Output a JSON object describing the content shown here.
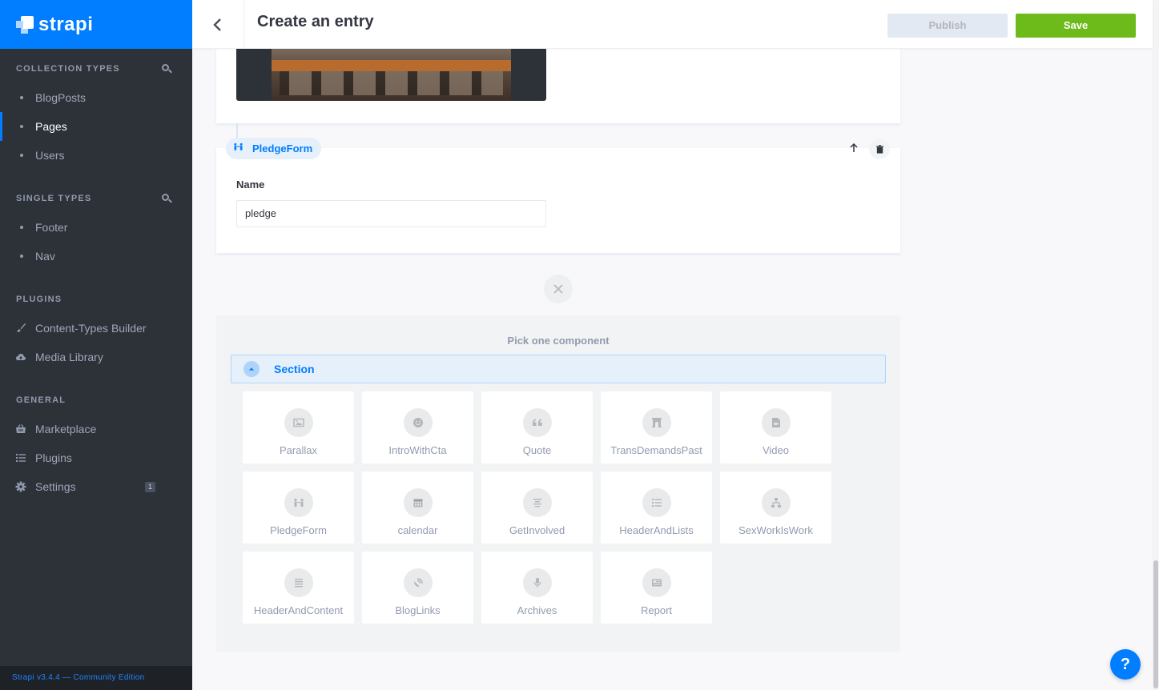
{
  "brand": {
    "name": "strapi"
  },
  "sidebar": {
    "sections": [
      {
        "title": "Collection Types",
        "search": true,
        "items": [
          {
            "label": "BlogPosts",
            "icon": "dot",
            "active": false
          },
          {
            "label": "Pages",
            "icon": "dot",
            "active": true
          },
          {
            "label": "Users",
            "icon": "dot",
            "active": false
          }
        ]
      },
      {
        "title": "Single Types",
        "search": true,
        "items": [
          {
            "label": "Footer",
            "icon": "dot"
          },
          {
            "label": "Nav",
            "icon": "dot"
          }
        ]
      },
      {
        "title": "Plugins",
        "search": false,
        "items": [
          {
            "label": "Content-Types Builder",
            "icon": "paint-brush-icon"
          },
          {
            "label": "Media Library",
            "icon": "cloud-upload-icon"
          }
        ]
      },
      {
        "title": "General",
        "search": false,
        "items": [
          {
            "label": "Marketplace",
            "icon": "basket-icon"
          },
          {
            "label": "Plugins",
            "icon": "list-icon"
          },
          {
            "label": "Settings",
            "icon": "gear-icon",
            "badge": "1"
          }
        ]
      }
    ],
    "version": "Strapi v3.4.4 — Community Edition"
  },
  "header": {
    "title": "Create an entry",
    "publish_label": "Publish",
    "save_label": "Save"
  },
  "component": {
    "name": "PledgeForm",
    "field_label": "Name",
    "field_value": "pledge"
  },
  "picker": {
    "title": "Pick one component",
    "category": "Section",
    "components": [
      {
        "label": "Parallax",
        "icon": "image-icon"
      },
      {
        "label": "IntroWithCta",
        "icon": "smile-icon"
      },
      {
        "label": "Quote",
        "icon": "quote-icon"
      },
      {
        "label": "TransDemandsPast",
        "icon": "archway-icon"
      },
      {
        "label": "Video",
        "icon": "file-video-icon"
      },
      {
        "label": "PledgeForm",
        "icon": "people-icon"
      },
      {
        "label": "calendar",
        "icon": "calendar-icon"
      },
      {
        "label": "GetInvolved",
        "icon": "align-center-icon"
      },
      {
        "label": "HeaderAndLists",
        "icon": "list-icon"
      },
      {
        "label": "SexWorkIsWork",
        "icon": "sitemap-icon"
      },
      {
        "label": "HeaderAndContent",
        "icon": "align-justify-icon"
      },
      {
        "label": "BlogLinks",
        "icon": "satellite-dish-icon"
      },
      {
        "label": "Archives",
        "icon": "microphone-icon"
      },
      {
        "label": "Report",
        "icon": "newspaper-icon"
      }
    ]
  },
  "help_label": "?",
  "colors": {
    "brand": "#007eff",
    "save": "#6dbb1a",
    "sidebar": "#2d3138"
  }
}
